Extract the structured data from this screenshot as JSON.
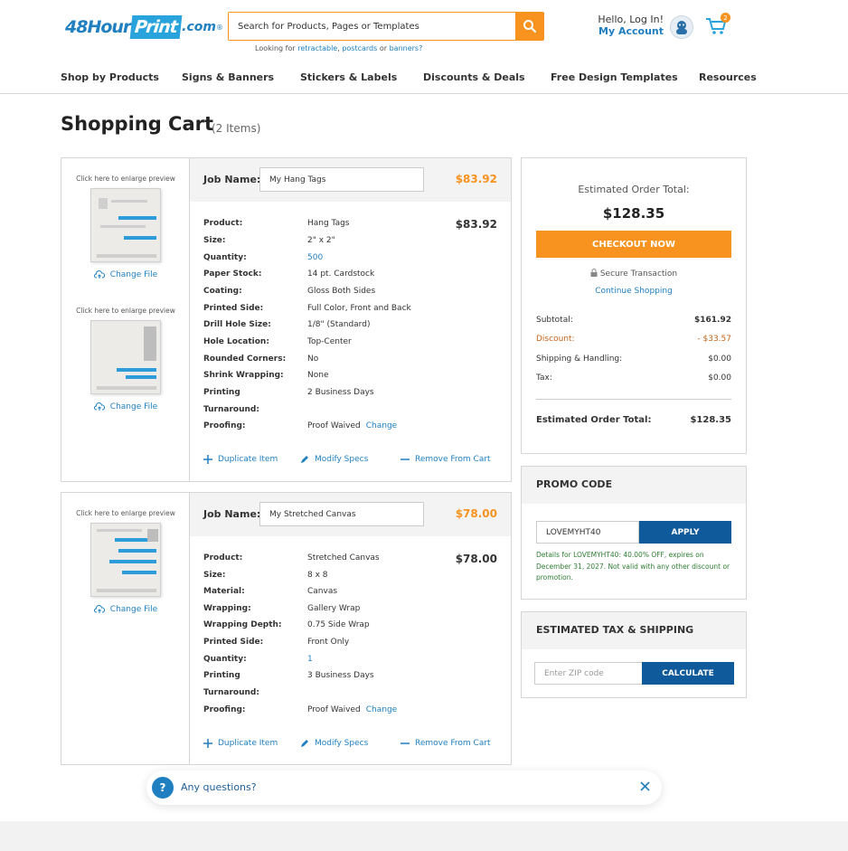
{
  "header": {
    "logo": {
      "part1": "48Hour",
      "part2": "Print",
      "part3": ".com",
      "reg": "®"
    },
    "search": {
      "placeholder": "Search for Products, Pages or Templates",
      "hint_prefix": "Looking for",
      "hint_links": [
        "retractable",
        "postcards",
        "banners?"
      ],
      "hint_or": "or"
    },
    "account": {
      "hello": "Hello, Log In!",
      "my_account": "My Account"
    },
    "cart_count": "2"
  },
  "nav": [
    "Shop by Products",
    "Signs & Banners",
    "Stickers & Labels",
    "Discounts & Deals",
    "Free Design Templates",
    "Resources"
  ],
  "page": {
    "title": "Shopping Cart",
    "count": "(2 Items)"
  },
  "labels": {
    "job_name": "Job Name:",
    "preview_caption": "Click here to enlarge preview",
    "change_file": "Change File",
    "change": "Change",
    "duplicate": "Duplicate Item",
    "modify": "Modify Specs",
    "remove": "Remove From Cart"
  },
  "items": [
    {
      "job_name": "My Hang Tags",
      "price": "$83.92",
      "specs": [
        {
          "k": "Product:",
          "v": "Hang Tags"
        },
        {
          "k": "Size:",
          "v": "2\" x 2\""
        },
        {
          "k": "Quantity:",
          "v": "500"
        },
        {
          "k": "Paper Stock:",
          "v": "14 pt. Cardstock"
        },
        {
          "k": "Coating:",
          "v": "Gloss Both Sides"
        },
        {
          "k": "Printed Side:",
          "v": "Full Color, Front and Back"
        },
        {
          "k": "Drill Hole Size:",
          "v": "1/8\" (Standard)"
        },
        {
          "k": "Hole Location:",
          "v": "Top-Center"
        },
        {
          "k": "Rounded Corners:",
          "v": "No"
        },
        {
          "k": "Shrink Wrapping:",
          "v": "None"
        },
        {
          "k": "Printing",
          "v": "2 Business Days"
        },
        {
          "k": "Turnaround:",
          "v": ""
        },
        {
          "k": "Proofing:",
          "v": "Proof Waived"
        }
      ]
    },
    {
      "job_name": "My Stretched Canvas",
      "price": "$78.00",
      "specs": [
        {
          "k": "Product:",
          "v": "Stretched Canvas"
        },
        {
          "k": "Size:",
          "v": "8 x 8"
        },
        {
          "k": "Material:",
          "v": "Canvas"
        },
        {
          "k": "Wrapping:",
          "v": "Gallery Wrap"
        },
        {
          "k": "Wrapping Depth:",
          "v": "0.75 Side Wrap"
        },
        {
          "k": "Printed Side:",
          "v": "Front Only"
        },
        {
          "k": "Quantity:",
          "v": "1"
        },
        {
          "k": "Printing",
          "v": "3 Business Days"
        },
        {
          "k": "Turnaround:",
          "v": ""
        },
        {
          "k": "Proofing:",
          "v": "Proof Waived"
        }
      ]
    }
  ],
  "summary": {
    "est_label": "Estimated Order Total:",
    "est_total": "$128.35",
    "checkout": "CHECKOUT NOW",
    "secure": "Secure Transaction",
    "continue": "Continue Shopping",
    "rows": [
      {
        "l": "Subtotal:",
        "r": "$161.92"
      },
      {
        "l": "Discount:",
        "r": "- $33.57"
      },
      {
        "l": "Shipping & Handling:",
        "r": "$0.00"
      },
      {
        "l": "Tax:",
        "r": "$0.00"
      }
    ],
    "total_label": "Estimated Order Total:",
    "total_value": "$128.35"
  },
  "promo": {
    "title": "PROMO CODE",
    "code": "LOVEMYHT40",
    "apply": "APPLY",
    "note": "Details for LOVEMYHT40: 40.00% OFF, expires on December 31, 2027. Not valid with any other discount or promotion."
  },
  "tax": {
    "title": "ESTIMATED TAX & SHIPPING",
    "placeholder": "Enter ZIP code",
    "button": "CALCULATE"
  },
  "chat": {
    "text": "Any questions?",
    "icon": "?"
  },
  "colors": {
    "accent": "#f7931e",
    "brand": "#1f7fc1",
    "dark_blue": "#0e5a9a",
    "discount": "#c4651a",
    "promo_note": "#2e7d32"
  }
}
